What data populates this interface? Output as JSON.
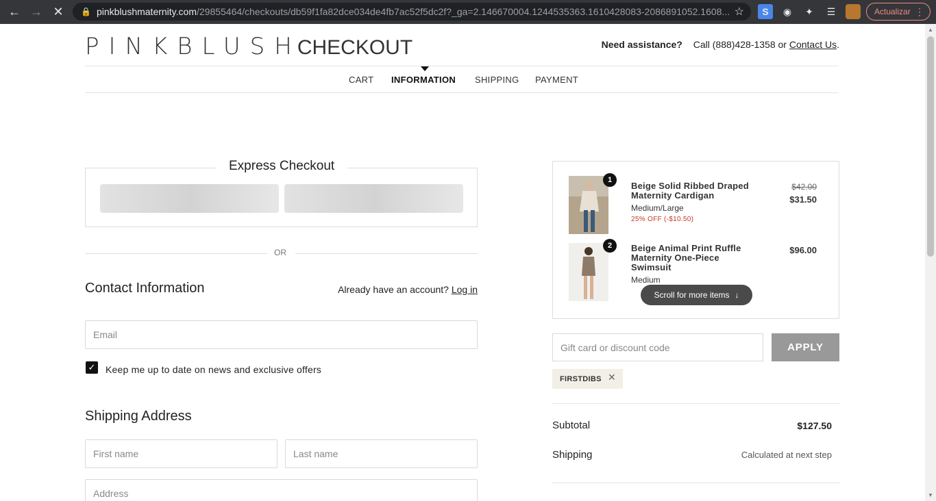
{
  "browser": {
    "url_host": "pinkblushmaternity.com",
    "url_path": "/29855464/checkouts/db59f1fa82dce034de4fb7ac52f5dc2f?_ga=2.146670004.1244535363.1610428083-2086891052.1608...",
    "update_label": "Actualizar"
  },
  "header": {
    "brand": "PINKBLUSH",
    "section": "CHECKOUT",
    "assist_label": "Need assistance?",
    "assist_text": "Call (888)428-1358 or",
    "contact_link": "Contact Us",
    "period": "."
  },
  "steps": [
    {
      "label": "CART"
    },
    {
      "label": "INFORMATION"
    },
    {
      "label": "SHIPPING"
    },
    {
      "label": "PAYMENT"
    }
  ],
  "express": {
    "title": "Express Checkout",
    "or": "OR"
  },
  "contact": {
    "title": "Contact Information",
    "account_text": "Already have an account?",
    "login_link": "Log in",
    "email_placeholder": "Email",
    "newsletter_label": "Keep me up to date on news and exclusive offers"
  },
  "shipping_address": {
    "title": "Shipping Address",
    "first_name_placeholder": "First name",
    "last_name_placeholder": "Last name",
    "address_placeholder": "Address"
  },
  "order": {
    "items": [
      {
        "qty": "1",
        "name": "Beige Solid Ribbed Draped Maternity Cardigan",
        "variant": "Medium/Large",
        "discount": "25% OFF (-$10.50)",
        "price_old": "$42.00",
        "price": "$31.50"
      },
      {
        "qty": "2",
        "name": "Beige Animal Print Ruffle Maternity One-Piece Swimsuit",
        "variant": "Medium",
        "price": "$96.00"
      }
    ],
    "scroll_label": "Scroll for more items",
    "gift_placeholder": "Gift card or discount code",
    "apply_label": "APPLY",
    "discount_tag": "FIRSTDIBS",
    "subtotal_label": "Subtotal",
    "subtotal_value": "$127.50",
    "shipping_label": "Shipping",
    "shipping_value": "Calculated at next step"
  },
  "colors": {
    "accent": "#111111",
    "discount_red": "#c0392b",
    "apply_gray": "#999999",
    "tag_bg": "#f2efe7"
  }
}
